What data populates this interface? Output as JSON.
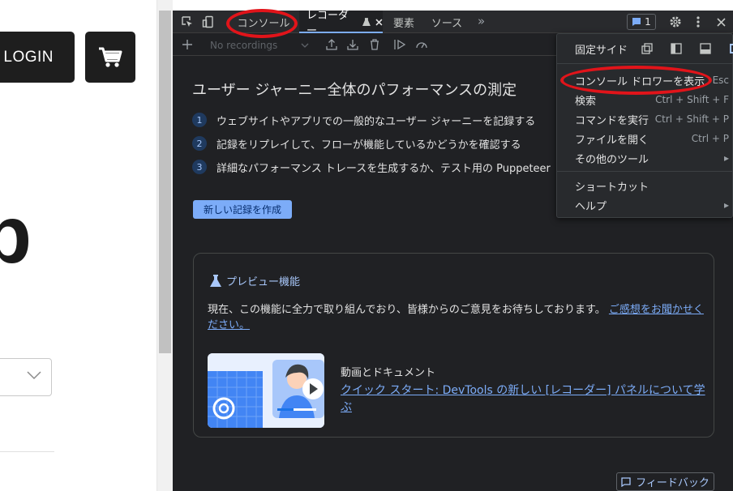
{
  "website": {
    "login_label": "LOGIN",
    "big_letter": "p"
  },
  "devtools": {
    "tabs": [
      "コンソール",
      "レコーダー",
      "要素",
      "ソース"
    ],
    "more_tabs": "»",
    "issues_count": "1",
    "recording_select": "No recordings",
    "heading": "ユーザー ジャーニー全体のパフォーマンスの測定",
    "steps": [
      {
        "num": "1",
        "text": "ウェブサイトやアプリでの一般的なユーザー ジャーニーを記録する"
      },
      {
        "num": "2",
        "text": "記録をリプレイして、フローが機能しているかどうかを確認する"
      },
      {
        "num": "3",
        "text": "詳細なパフォーマンス トレースを生成するか、テスト用の Puppeteer"
      }
    ],
    "create_button": "新しい記録を作成",
    "preview": {
      "title": "プレビュー機能",
      "text": "現在、この機能に全力で取り組んでおり、皆様からのご意見をお待ちしております。",
      "link": "ご感想をお聞かせください。",
      "media_title": "動画とドキュメント",
      "media_link": "クイック スタート: DevTools の新しい [レコーダー] パネルについて学ぶ"
    },
    "feedback_button": "フィードバック"
  },
  "menu": {
    "dock_label": "固定サイド",
    "items": [
      {
        "label": "コンソール ドロワーを表示",
        "shortcut": "Esc"
      },
      {
        "label": "検索",
        "shortcut": "Ctrl + Shift + F"
      },
      {
        "label": "コマンドを実行",
        "shortcut": "Ctrl + Shift + P"
      },
      {
        "label": "ファイルを開く",
        "shortcut": "Ctrl + P"
      },
      {
        "label": "その他のツール",
        "shortcut": "▸"
      },
      {
        "label": "ショートカット",
        "shortcut": ""
      },
      {
        "label": "ヘルプ",
        "shortcut": "▸"
      }
    ]
  },
  "colors": {
    "annotation": "#e1141a",
    "accent": "#7cacf8",
    "panel_bg": "#202124"
  }
}
